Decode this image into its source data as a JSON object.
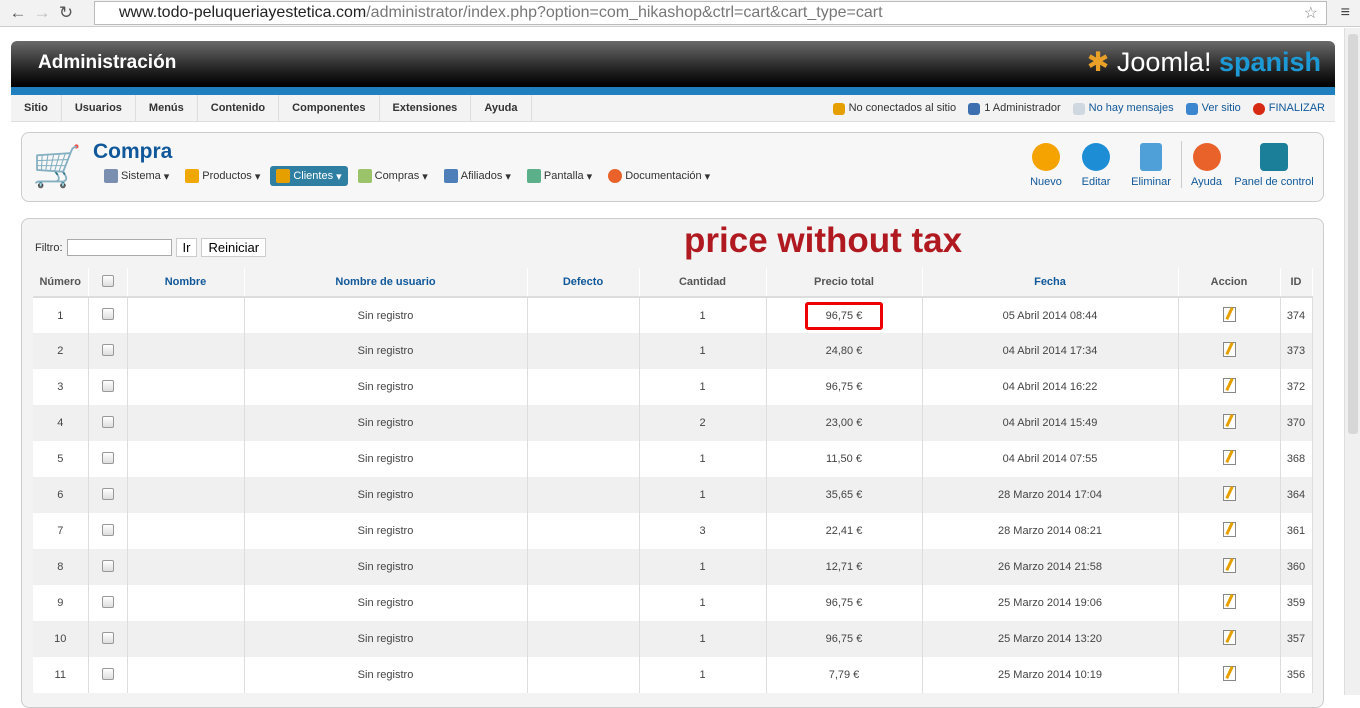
{
  "browser": {
    "url_domain": "www.todo-peluqueriayestetica.com",
    "url_path": "/administrator/index.php?option=com_hikashop&ctrl=cart&cart_type=cart"
  },
  "header": {
    "title": "Administración",
    "logo_text": "Joomla!",
    "logo_lang": "spanish"
  },
  "top_menu": [
    "Sitio",
    "Usuarios",
    "Menús",
    "Contenido",
    "Componentes",
    "Extensiones",
    "Ayuda"
  ],
  "status": {
    "online": "No conectados al sitio",
    "admins": "1 Administrador",
    "messages": "No hay mensajes",
    "view_site": "Ver sitio",
    "logout": "FINALIZAR"
  },
  "toolbar": {
    "title": "Compra",
    "submenu": [
      "Sistema",
      "Productos",
      "Clientes",
      "Compras",
      "Afiliados",
      "Pantalla",
      "Documentación"
    ],
    "buttons": [
      "Nuevo",
      "Editar",
      "Eliminar",
      "Ayuda",
      "Panel de control"
    ]
  },
  "filter": {
    "label": "Filtro:",
    "value": "",
    "go": "Ir",
    "reset": "Reiniciar"
  },
  "annotation": "price without tax",
  "colors": {
    "accent": "#10589a",
    "annotation": "#b0191f",
    "highlight": "#e00000"
  },
  "table": {
    "headers": [
      "Número",
      "",
      "Nombre",
      "Nombre de usuario",
      "Defecto",
      "Cantidad",
      "Precio total",
      "Fecha",
      "Accion",
      "ID"
    ],
    "rows": [
      {
        "n": "1",
        "user": "Sin registro",
        "qty": "1",
        "price": "96,75 €",
        "date": "05 Abril 2014 08:44",
        "id": "374"
      },
      {
        "n": "2",
        "user": "Sin registro",
        "qty": "1",
        "price": "24,80 €",
        "date": "04 Abril 2014 17:34",
        "id": "373"
      },
      {
        "n": "3",
        "user": "Sin registro",
        "qty": "1",
        "price": "96,75 €",
        "date": "04 Abril 2014 16:22",
        "id": "372"
      },
      {
        "n": "4",
        "user": "Sin registro",
        "qty": "2",
        "price": "23,00 €",
        "date": "04 Abril 2014 15:49",
        "id": "370"
      },
      {
        "n": "5",
        "user": "Sin registro",
        "qty": "1",
        "price": "11,50 €",
        "date": "04 Abril 2014 07:55",
        "id": "368"
      },
      {
        "n": "6",
        "user": "Sin registro",
        "qty": "1",
        "price": "35,65 €",
        "date": "28 Marzo 2014 17:04",
        "id": "364"
      },
      {
        "n": "7",
        "user": "Sin registro",
        "qty": "3",
        "price": "22,41 €",
        "date": "28 Marzo 2014 08:21",
        "id": "361"
      },
      {
        "n": "8",
        "user": "Sin registro",
        "qty": "1",
        "price": "12,71 €",
        "date": "26 Marzo 2014 21:58",
        "id": "360"
      },
      {
        "n": "9",
        "user": "Sin registro",
        "qty": "1",
        "price": "96,75 €",
        "date": "25 Marzo 2014 19:06",
        "id": "359"
      },
      {
        "n": "10",
        "user": "Sin registro",
        "qty": "1",
        "price": "96,75 €",
        "date": "25 Marzo 2014 13:20",
        "id": "357"
      },
      {
        "n": "11",
        "user": "Sin registro",
        "qty": "1",
        "price": "7,79 €",
        "date": "25 Marzo 2014 10:19",
        "id": "356"
      }
    ]
  }
}
